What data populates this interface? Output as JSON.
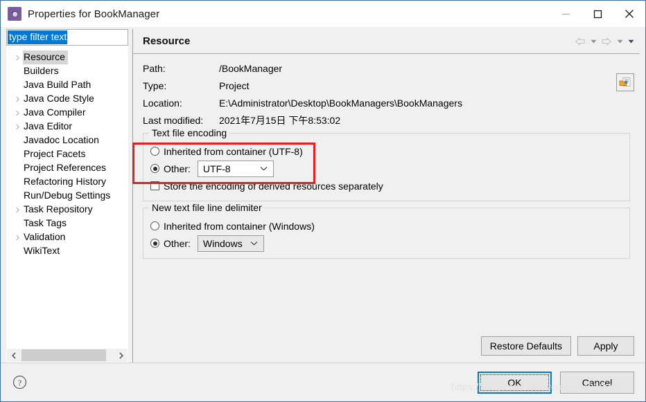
{
  "window": {
    "title": "Properties for BookManager",
    "icon": "gear-icon",
    "controls": {
      "minimize": "–",
      "maximize": "□",
      "close": "✕"
    }
  },
  "sidebar": {
    "filter": {
      "value": "type filter text",
      "placeholder": "type filter text"
    },
    "items": [
      {
        "label": "Resource",
        "expandable": true,
        "selected": true
      },
      {
        "label": "Builders",
        "expandable": false,
        "selected": false
      },
      {
        "label": "Java Build Path",
        "expandable": false,
        "selected": false
      },
      {
        "label": "Java Code Style",
        "expandable": true,
        "selected": false
      },
      {
        "label": "Java Compiler",
        "expandable": true,
        "selected": false
      },
      {
        "label": "Java Editor",
        "expandable": true,
        "selected": false
      },
      {
        "label": "Javadoc Location",
        "expandable": false,
        "selected": false
      },
      {
        "label": "Project Facets",
        "expandable": false,
        "selected": false
      },
      {
        "label": "Project References",
        "expandable": false,
        "selected": false
      },
      {
        "label": "Refactoring History",
        "expandable": false,
        "selected": false
      },
      {
        "label": "Run/Debug Settings",
        "expandable": false,
        "selected": false
      },
      {
        "label": "Task Repository",
        "expandable": true,
        "selected": false
      },
      {
        "label": "Task Tags",
        "expandable": false,
        "selected": false
      },
      {
        "label": "Validation",
        "expandable": true,
        "selected": false
      },
      {
        "label": "WikiText",
        "expandable": false,
        "selected": false
      }
    ],
    "scroll_left_icon": "chevron-left-icon",
    "scroll_right_icon": "chevron-right-icon"
  },
  "content": {
    "title": "Resource",
    "nav": {
      "back_icon": "back-arrow-icon",
      "back_menu_icon": "chevron-down-icon",
      "forward_icon": "forward-arrow-icon",
      "forward_menu_icon": "chevron-down-icon",
      "view_menu_icon": "chevron-down-icon"
    },
    "properties": [
      {
        "label": "Path:",
        "value": "/BookManager"
      },
      {
        "label": "Type:",
        "value": "Project"
      },
      {
        "label": "Location:",
        "value": "E:\\Administrator\\Desktop\\BookManagers\\BookManagers"
      },
      {
        "label": "Last modified:",
        "value": "2021年7月15日 下午8:53:02"
      }
    ],
    "location_button_icon": "folder-variable-icon",
    "encoding_group": {
      "title": "Text file encoding",
      "inherited_label": "Inherited from container (UTF-8)",
      "inherited_selected": false,
      "other_label": "Other:",
      "other_selected": true,
      "other_value": "UTF-8",
      "store_derived_label": "Store the encoding of derived resources separately",
      "store_derived_checked": false
    },
    "delimiter_group": {
      "title": "New text file line delimiter",
      "inherited_label": "Inherited from container (Windows)",
      "inherited_selected": false,
      "other_label": "Other:",
      "other_selected": true,
      "other_value": "Windows"
    },
    "buttons": {
      "restore_defaults": "Restore Defaults",
      "apply": "Apply"
    }
  },
  "footer": {
    "help_icon": "help-question-icon",
    "ok": "OK",
    "cancel": "Cancel",
    "watermark": "https://blog.csdn.net/weixin_44893902"
  },
  "colors": {
    "accent": "#0078d7",
    "annotation": "#ee1c1c",
    "window_border": "#3f6fa8"
  }
}
